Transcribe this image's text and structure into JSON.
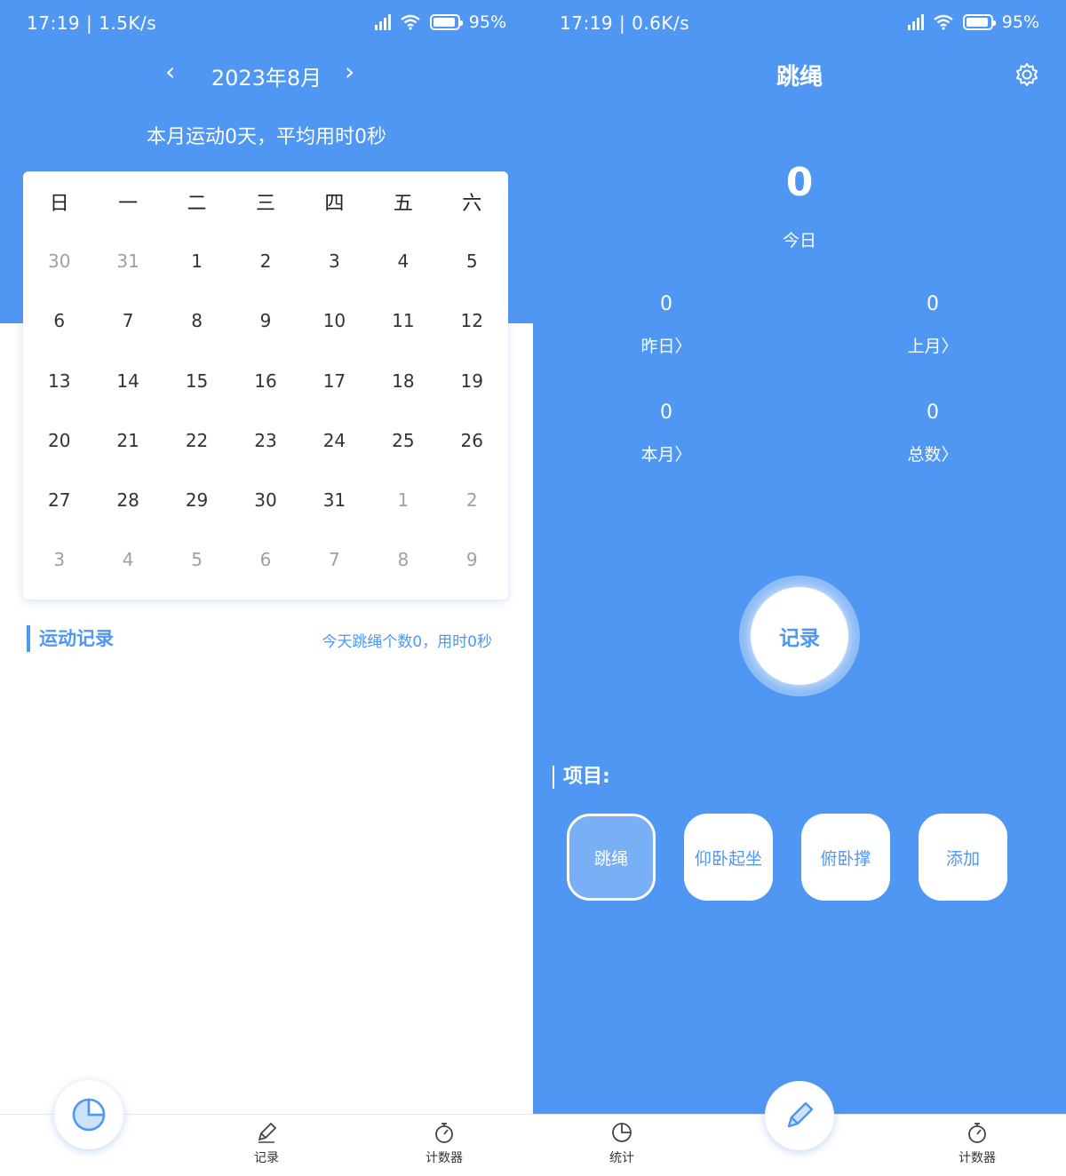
{
  "left": {
    "status": {
      "time": "17:19 | 1.5K/s",
      "battery": "95%"
    },
    "month_label": "2023年8月",
    "summary": "本月运动0天，平均用时0秒",
    "weekdays": [
      "日",
      "一",
      "二",
      "三",
      "四",
      "五",
      "六"
    ],
    "days": [
      {
        "d": "30",
        "muted": true
      },
      {
        "d": "31",
        "muted": true
      },
      {
        "d": "1"
      },
      {
        "d": "2"
      },
      {
        "d": "3"
      },
      {
        "d": "4"
      },
      {
        "d": "5"
      },
      {
        "d": "6"
      },
      {
        "d": "7"
      },
      {
        "d": "8"
      },
      {
        "d": "9"
      },
      {
        "d": "10"
      },
      {
        "d": "11"
      },
      {
        "d": "12"
      },
      {
        "d": "13"
      },
      {
        "d": "14"
      },
      {
        "d": "15"
      },
      {
        "d": "16"
      },
      {
        "d": "17"
      },
      {
        "d": "18"
      },
      {
        "d": "19"
      },
      {
        "d": "20"
      },
      {
        "d": "21"
      },
      {
        "d": "22"
      },
      {
        "d": "23"
      },
      {
        "d": "24"
      },
      {
        "d": "25"
      },
      {
        "d": "26"
      },
      {
        "d": "27"
      },
      {
        "d": "28"
      },
      {
        "d": "29"
      },
      {
        "d": "30"
      },
      {
        "d": "31"
      },
      {
        "d": "1",
        "muted": true
      },
      {
        "d": "2",
        "muted": true
      },
      {
        "d": "3",
        "muted": true
      },
      {
        "d": "4",
        "muted": true
      },
      {
        "d": "5",
        "muted": true
      },
      {
        "d": "6",
        "muted": true
      },
      {
        "d": "7",
        "muted": true
      },
      {
        "d": "8",
        "muted": true
      },
      {
        "d": "9",
        "muted": true
      }
    ],
    "records_title": "运动记录",
    "records_summary": "今天跳绳个数0，用时0秒",
    "nav": {
      "record": "记录",
      "timer": "计数器"
    }
  },
  "right": {
    "status": {
      "time": "17:19 | 0.6K/s",
      "battery": "95%"
    },
    "title": "跳绳",
    "today": {
      "value": "0",
      "label": "今日"
    },
    "stats": [
      {
        "value": "0",
        "label": "昨日〉"
      },
      {
        "value": "0",
        "label": "上月〉"
      },
      {
        "value": "0",
        "label": "本月〉"
      },
      {
        "value": "0",
        "label": "总数〉"
      }
    ],
    "record_button": "记录",
    "projects_title": "项目:",
    "projects": [
      "跳绳",
      "仰卧起坐",
      "俯卧撑",
      "添加"
    ],
    "nav": {
      "stats": "统计",
      "timer": "计数器"
    }
  },
  "colors": {
    "accent": "#4f97f2",
    "muted_day": "#a0a0a0"
  }
}
